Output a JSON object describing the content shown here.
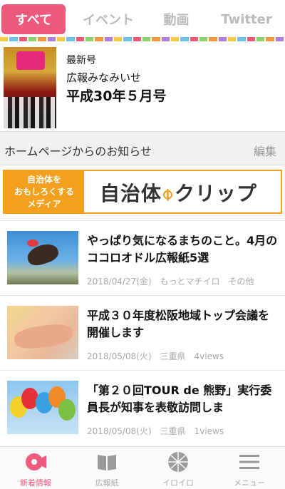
{
  "tabs": [
    {
      "label": "すべて",
      "active": true
    },
    {
      "label": "イベント",
      "active": false
    },
    {
      "label": "動画",
      "active": false
    },
    {
      "label": "Twitter",
      "active": false
    }
  ],
  "latest_issue": {
    "label": "最新号",
    "name": "広報みなみいせ",
    "title": "平成30年５月号"
  },
  "notice": {
    "title": "ホームページからのお知らせ",
    "edit_label": "編集"
  },
  "banner": {
    "left_line1": "自治体を",
    "left_line2": "おもしろくする",
    "left_line3": "メディア",
    "main_text_a": "自治体",
    "main_text_b": "クリップ"
  },
  "articles": [
    {
      "title": "やっぱり気になるまちのこと。4月のココロオドル広報紙5選",
      "date": "2018/04/27(金)",
      "source": "もっとマチイロ",
      "tag": "その他"
    },
    {
      "title": "平成３０年度松阪地域トップ会議を開催します",
      "date": "2018/05/08(火)",
      "source": "三重県",
      "tag": "4views"
    },
    {
      "title": "「第２０回TOUR de 熊野」実行委員長が知事を表敬訪問しま",
      "date": "2018/05/08(火)",
      "source": "三重県",
      "tag": "1views"
    }
  ],
  "bottom_nav": [
    {
      "label": "新着情報",
      "icon": "megaphone-icon",
      "active": true
    },
    {
      "label": "広報紙",
      "icon": "book-icon",
      "active": false
    },
    {
      "label": "イロイロ",
      "icon": "globe-icon",
      "active": false
    },
    {
      "label": "メニュー",
      "icon": "menu-icon",
      "active": false
    }
  ],
  "colors": {
    "accent": "#ee5a7b",
    "banner_orange": "#f2a01e",
    "inactive": "#aaaaaa"
  }
}
